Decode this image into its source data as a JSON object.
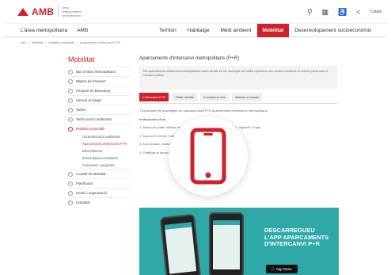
{
  "header": {
    "logo_text": "AMB",
    "logo_sub": "Àrea Metropolitana de Barcelona",
    "lang": "Català"
  },
  "nav": {
    "home": "L'àrea metropolitana",
    "amb": "AMB",
    "items": [
      "Territori",
      "Habitatge",
      "Medi ambient",
      "Mobilitat",
      "Desenvolupament socioeconòmic"
    ]
  },
  "breadcrumb": [
    "Inici",
    "Mobilitat",
    "Mobilitat sostenible",
    "Aparcaments d'intercanvi P+R"
  ],
  "sidebar": {
    "title": "Mobilitat",
    "items": [
      "Bus a l'àrea metropolitana",
      "Mitjans de transport",
      "Aeroport de Barcelona",
      "Atenció al viatger",
      "Tarifes",
      "Tarifa social i ambiental",
      "Mobilitat sostenible"
    ],
    "sub_items": [
      "Conscienciació ambiental",
      "Aparcaments d'intercanvi P+R",
      "Electrolineres",
      "Zones baixes emissions",
      "Actuacions i projectes"
    ],
    "items_after": [
      "Consell de Mobilitat",
      "Planificació",
      "Gestió i organització",
      "Actualitat"
    ]
  },
  "main": {
    "title": "Aparcaments d'intercanvi metropolitans (P+R)",
    "intro": "Els aparcaments d'intercanvi metropolitans estan situats en els municipis de l'AMB i permeten als usuaris combinar el vehicle privat amb el transport públic.",
    "tabs": [
      "L'intercanvi P+R",
      "Títols i tarifes",
      "Condicions d'ús",
      "Atenció a l'usuari"
    ],
    "body": [
      "T'expliquem els avantatges de l'aplicació AMB P+R Aparcaments d'intercanvi metropolitans.",
      "Instruccions d'ús:",
      "1. Abans de poder utilitzar els aparcaments d'intercanvi metropolitans, registra't a l'app.",
      "2. Aparca el vehicle i valida el teu títol de transport públic.",
      "3. A la tornada, valida el tiquet a la màquina expenedora.",
      "4. Finalitzar el servei."
    ]
  },
  "banner": {
    "headline_1": "Descarregueu",
    "headline_2": "l'app Aparcaments",
    "headline_3": "d'intercanvi P+R",
    "store": "App Store"
  },
  "colors": {
    "accent": "#d0202b",
    "banner": "#2fa8a8"
  }
}
